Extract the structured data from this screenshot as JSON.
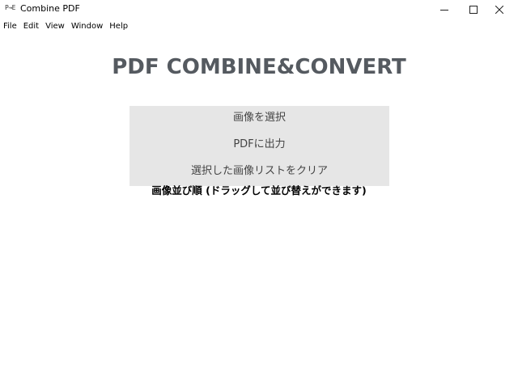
{
  "window": {
    "app_icon_text": "P→E",
    "title": "Combine PDF"
  },
  "menu": {
    "items": [
      "File",
      "Edit",
      "View",
      "Window",
      "Help"
    ]
  },
  "main": {
    "heading": "PDF COMBINE&CONVERT",
    "buttons": {
      "select_images": "画像を選択",
      "output_pdf": "PDFに出力",
      "clear_list": "選択した画像リストをクリア"
    },
    "order_label": "画像並び順 (ドラッグして並び替えができます)"
  },
  "colors": {
    "heading": "#555a60",
    "panel_background": "#e6e6e6",
    "button_text": "#444444"
  }
}
